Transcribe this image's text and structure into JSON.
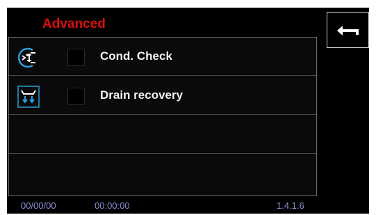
{
  "header": {
    "title": "Advanced"
  },
  "back_button": {
    "icon": "back-arrow-icon"
  },
  "options": [
    {
      "icon": "cond-check-icon",
      "label": "Cond. Check",
      "checked": false
    },
    {
      "icon": "drain-recovery-icon",
      "label": "Drain recovery",
      "checked": false
    }
  ],
  "status_bar": {
    "date": "00/00/00",
    "time": "00:00:00",
    "version": "1.4.1.6"
  },
  "colors": {
    "title": "#e00d0d",
    "accent": "#2a9fd8",
    "status_text": "#8b8fd6"
  }
}
